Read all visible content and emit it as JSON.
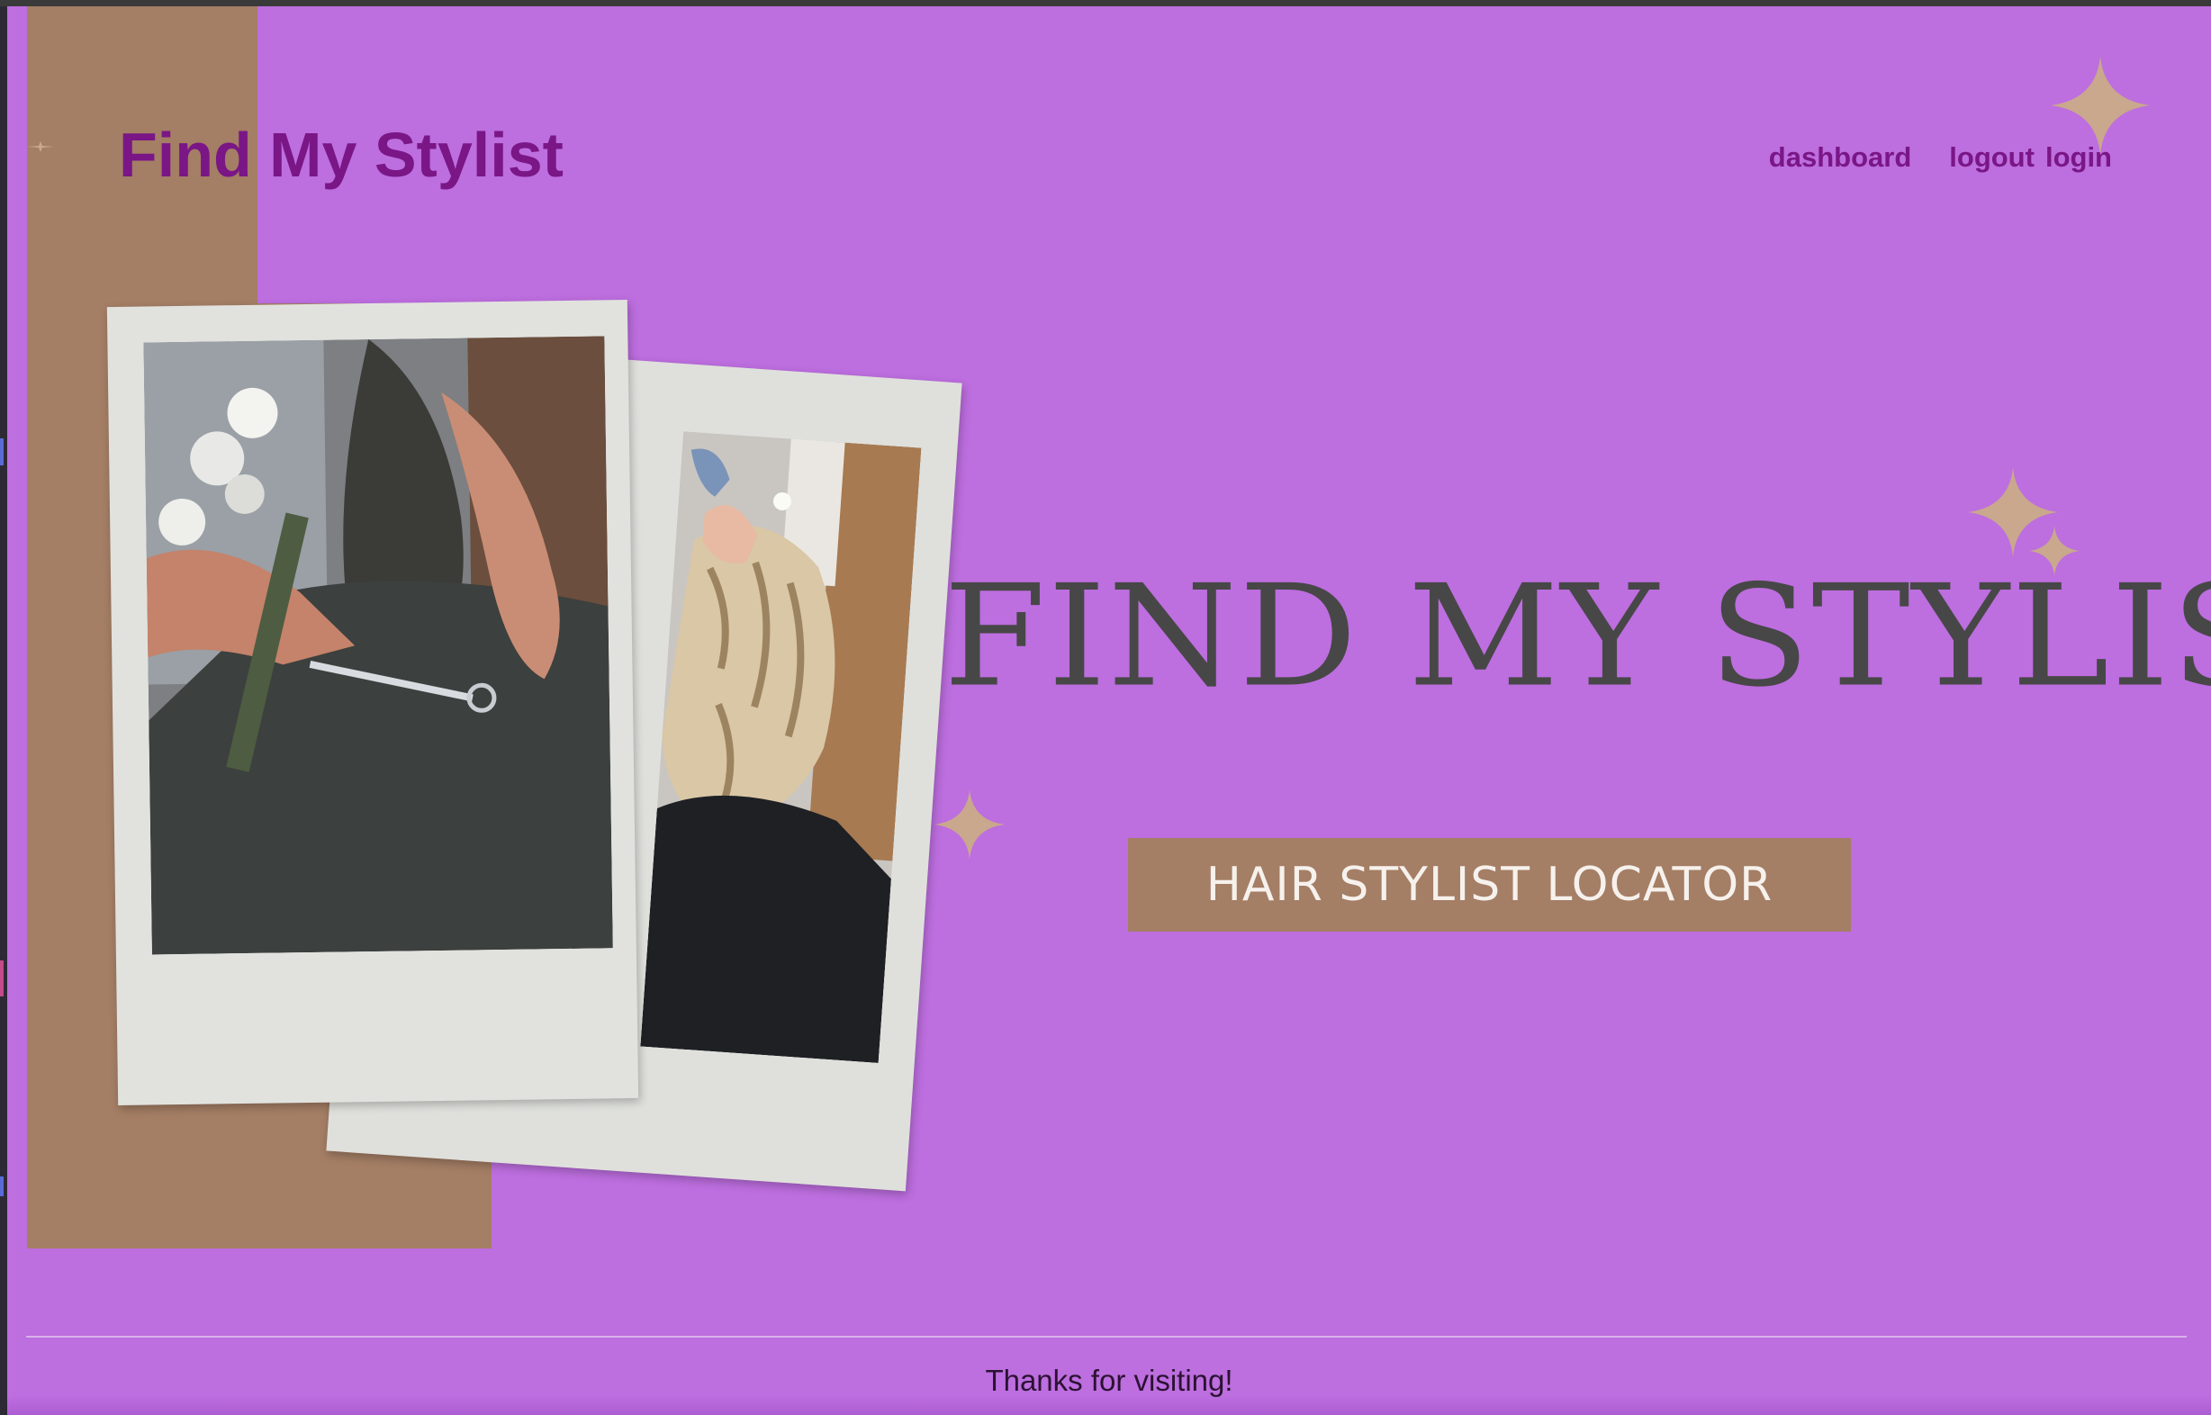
{
  "header": {
    "logo_text": "Find My Stylist",
    "nav": [
      {
        "label": "dashboard"
      },
      {
        "label": "logout"
      },
      {
        "label": "login"
      }
    ]
  },
  "hero": {
    "title": "FIND MY STYLIST",
    "button_label": "HAIR STYLIST LOCATOR"
  },
  "footer": {
    "text": "Thanks for visiting!"
  },
  "colors": {
    "background": "#bd6edf",
    "accent_brown": "#a47e65",
    "logo_purple": "#7a1686",
    "title_gray": "#474747",
    "sparkle": "#c9a88e"
  },
  "icons": [
    "sparkle-icon"
  ]
}
